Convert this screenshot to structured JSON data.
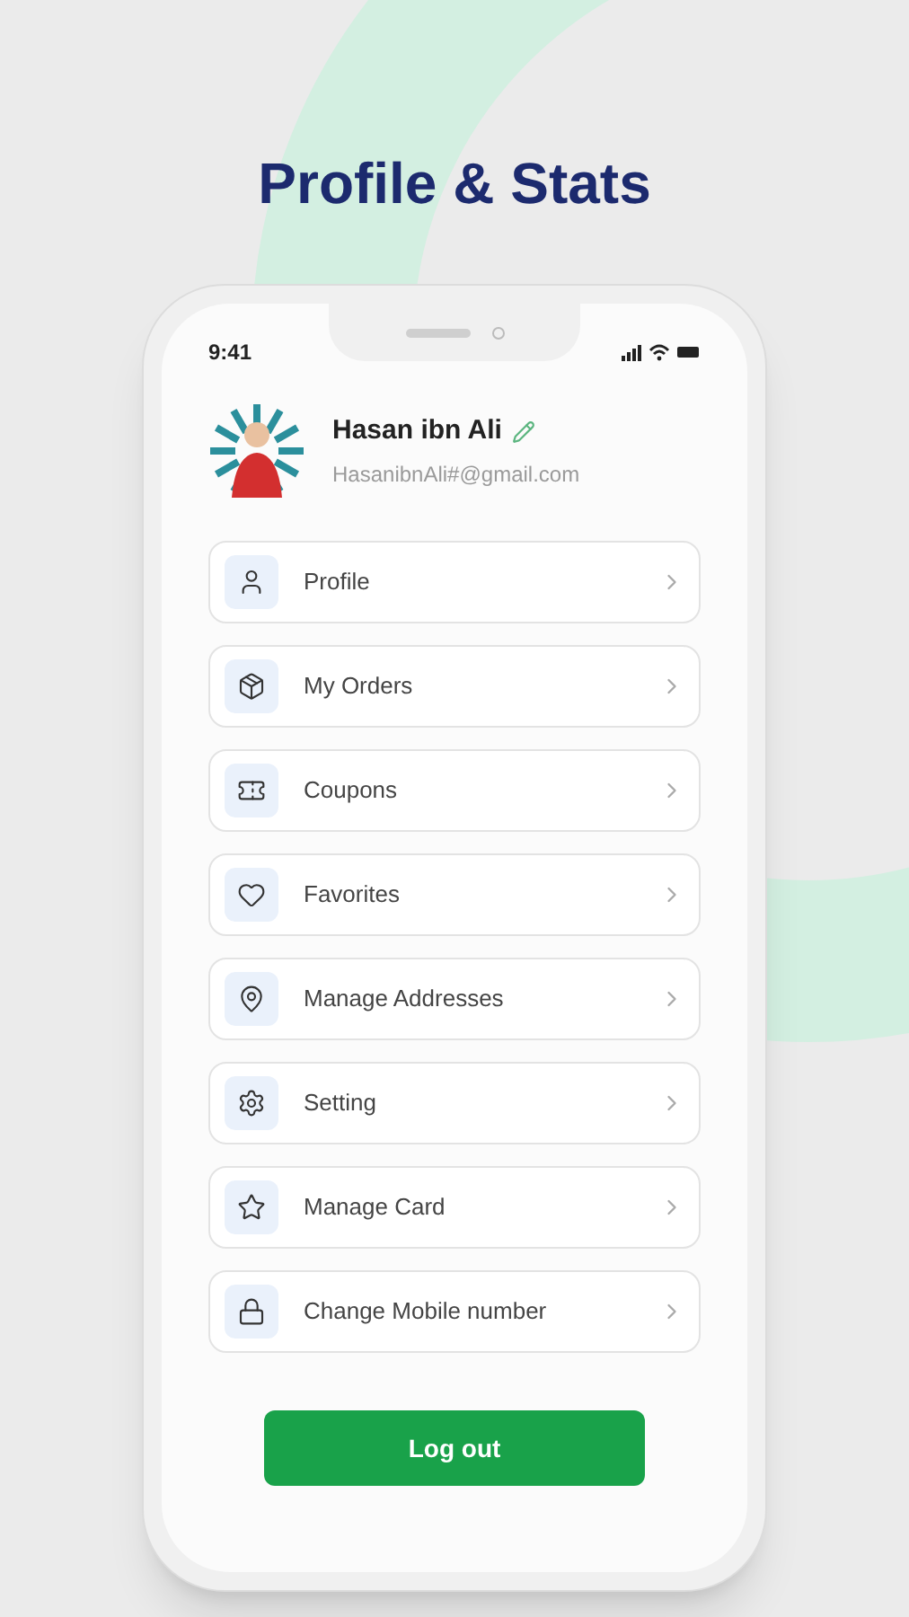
{
  "heading": "Profile & Stats",
  "status_bar": {
    "time": "9:41"
  },
  "user": {
    "name": "Hasan ibn Ali",
    "email": "HasanibnAli#@gmail.com"
  },
  "menu": [
    {
      "label": "Profile"
    },
    {
      "label": "My Orders"
    },
    {
      "label": "Coupons"
    },
    {
      "label": "Favorites"
    },
    {
      "label": "Manage Addresses"
    },
    {
      "label": "Setting"
    },
    {
      "label": "Manage Card"
    },
    {
      "label": "Change Mobile number"
    }
  ],
  "logout_button": "Log out"
}
